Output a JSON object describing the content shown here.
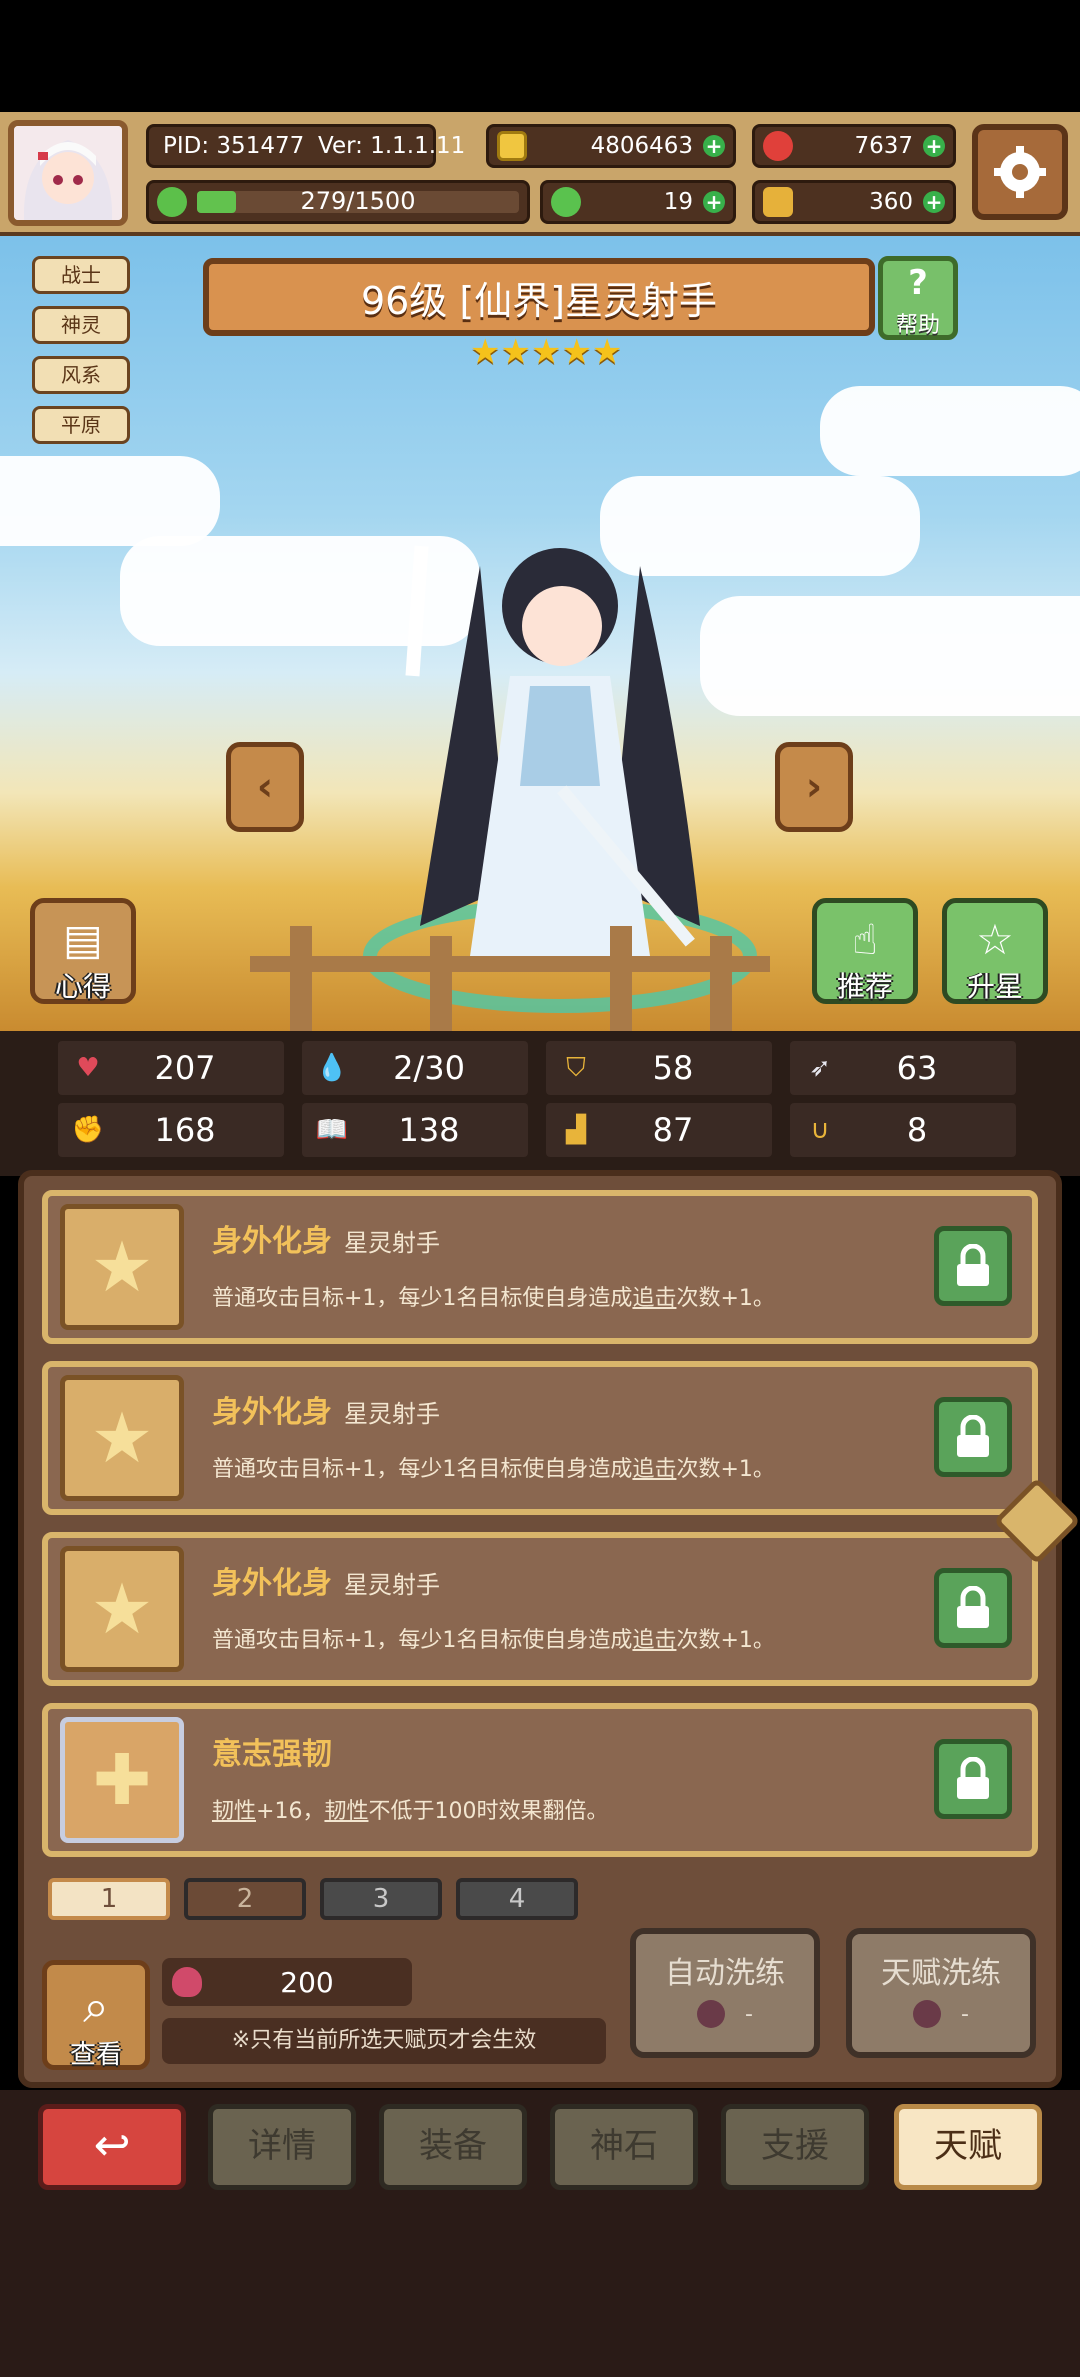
{
  "header": {
    "pid": "PID: 351477",
    "version": "Ver: 1.1.1.11",
    "gold": "4806463",
    "gems": "7637",
    "energy": "279/1500",
    "clover": "19",
    "keys": "360"
  },
  "tags": [
    "战士",
    "神灵",
    "风系",
    "平原"
  ],
  "hero": {
    "title": "96级 [仙界]星灵射手",
    "stars": "★★★★★",
    "help_label": "帮助"
  },
  "side_buttons": {
    "insight": "心得",
    "recommend": "推荐",
    "star_up": "升星"
  },
  "stats": [
    {
      "icon": "heart-icon",
      "value": "207"
    },
    {
      "icon": "water-drop-icon",
      "value": "2/30"
    },
    {
      "icon": "shield-icon",
      "value": "58"
    },
    {
      "icon": "wing-icon",
      "value": "63"
    },
    {
      "icon": "fist-icon",
      "value": "168"
    },
    {
      "icon": "book-icon",
      "value": "138"
    },
    {
      "icon": "boot-icon",
      "value": "87"
    },
    {
      "icon": "horseshoe-icon",
      "value": "8"
    }
  ],
  "talents": [
    {
      "name": "身外化身",
      "sub": "星灵射手",
      "desc_a": "普通攻击目标+1，每少1名目标使自身造成",
      "desc_u": "追击",
      "desc_b": "次数+1。"
    },
    {
      "name": "身外化身",
      "sub": "星灵射手",
      "desc_a": "普通攻击目标+1，每少1名目标使自身造成",
      "desc_u": "追击",
      "desc_b": "次数+1。"
    },
    {
      "name": "身外化身",
      "sub": "星灵射手",
      "desc_a": "普通攻击目标+1，每少1名目标使自身造成",
      "desc_u": "追击",
      "desc_b": "次数+1。"
    },
    {
      "name": "意志强韧",
      "sub": "",
      "desc_u1": "韧性",
      "desc_a": "+16，",
      "desc_u2": "韧性",
      "desc_b": "不低于100时效果翻倍。"
    }
  ],
  "pages": [
    "1",
    "2",
    "3",
    "4"
  ],
  "footer": {
    "view_label": "查看",
    "cost": "200",
    "note": "※只有当前所选天赋页才会生效",
    "auto_wash": "自动洗练",
    "talent_wash": "天赋洗练",
    "wash_cost": "-"
  },
  "nav": [
    "详情",
    "装备",
    "神石",
    "支援",
    "天赋"
  ],
  "colors": {
    "accent_gold": "#f2c15a",
    "active_tab": "#f8e6c4",
    "back_red": "#d6453f"
  }
}
